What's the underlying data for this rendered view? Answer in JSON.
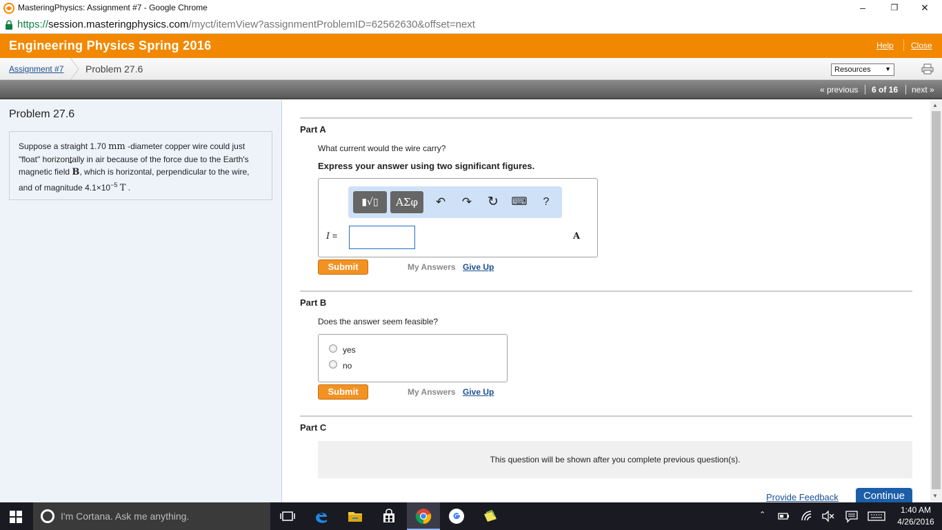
{
  "window": {
    "title": "MasteringPhysics: Assignment #7 - Google Chrome",
    "minimize": "–",
    "restore": "❐",
    "close": "✕"
  },
  "address": {
    "scheme": "https://",
    "host": "session.masteringphysics.com",
    "path": "/myct/itemView?assignmentProblemID=62562630&offset=next"
  },
  "header": {
    "course": "Engineering Physics Spring 2016",
    "help": "Help",
    "close": "Close"
  },
  "breadcrumb": {
    "assignment": "Assignment #7",
    "problem": "Problem 27.6",
    "resources": "Resources",
    "resources_arrow": "▼"
  },
  "nav": {
    "previous": "« previous",
    "position": "6 of 16",
    "next": "next »"
  },
  "problem": {
    "title": "Problem 27.6",
    "text_1": "Suppose a straight 1.70 ",
    "unit_mm": "mm",
    "text_2": " -diameter copper wire could just \"float\" horizontally in air because of the force due to the Earth's magnetic field ",
    "field_symbol": "B",
    "text_3": ", which is horizontal, perpendicular to the wire, and of magnitude 4.1×10",
    "exponent": "−5",
    "unit_T": "T",
    "text_4": " ."
  },
  "partA": {
    "heading": "Part A",
    "question": "What current would the wire carry?",
    "instruction": "Express your answer using two significant figures.",
    "toolbar": {
      "templates": "▮√▯",
      "symbols": "ΑΣφ",
      "undo": "↶",
      "redo": "↷",
      "reset": "↻",
      "keyboard": "⌨",
      "help": "?"
    },
    "variable": "I",
    "equals": " =",
    "input_value": "",
    "unit": "A",
    "submit": "Submit",
    "my_answers": "My Answers",
    "give_up": "Give Up"
  },
  "partB": {
    "heading": "Part B",
    "question": "Does the answer seem feasible?",
    "options": [
      "yes",
      "no"
    ],
    "submit": "Submit",
    "my_answers": "My Answers",
    "give_up": "Give Up"
  },
  "partC": {
    "heading": "Part C",
    "locked_message": "This question will be shown after you complete previous question(s)."
  },
  "footer": {
    "feedback": "Provide Feedback",
    "continue": "Continue"
  },
  "taskbar": {
    "cortana": "I'm Cortana. Ask me anything.",
    "time": "1:40 AM",
    "date": "4/26/2016"
  },
  "colors": {
    "accent_orange": "#f28800",
    "submit_orange": "#f39222",
    "link_blue": "#1a4f91",
    "continue_blue": "#1c5fa8"
  }
}
